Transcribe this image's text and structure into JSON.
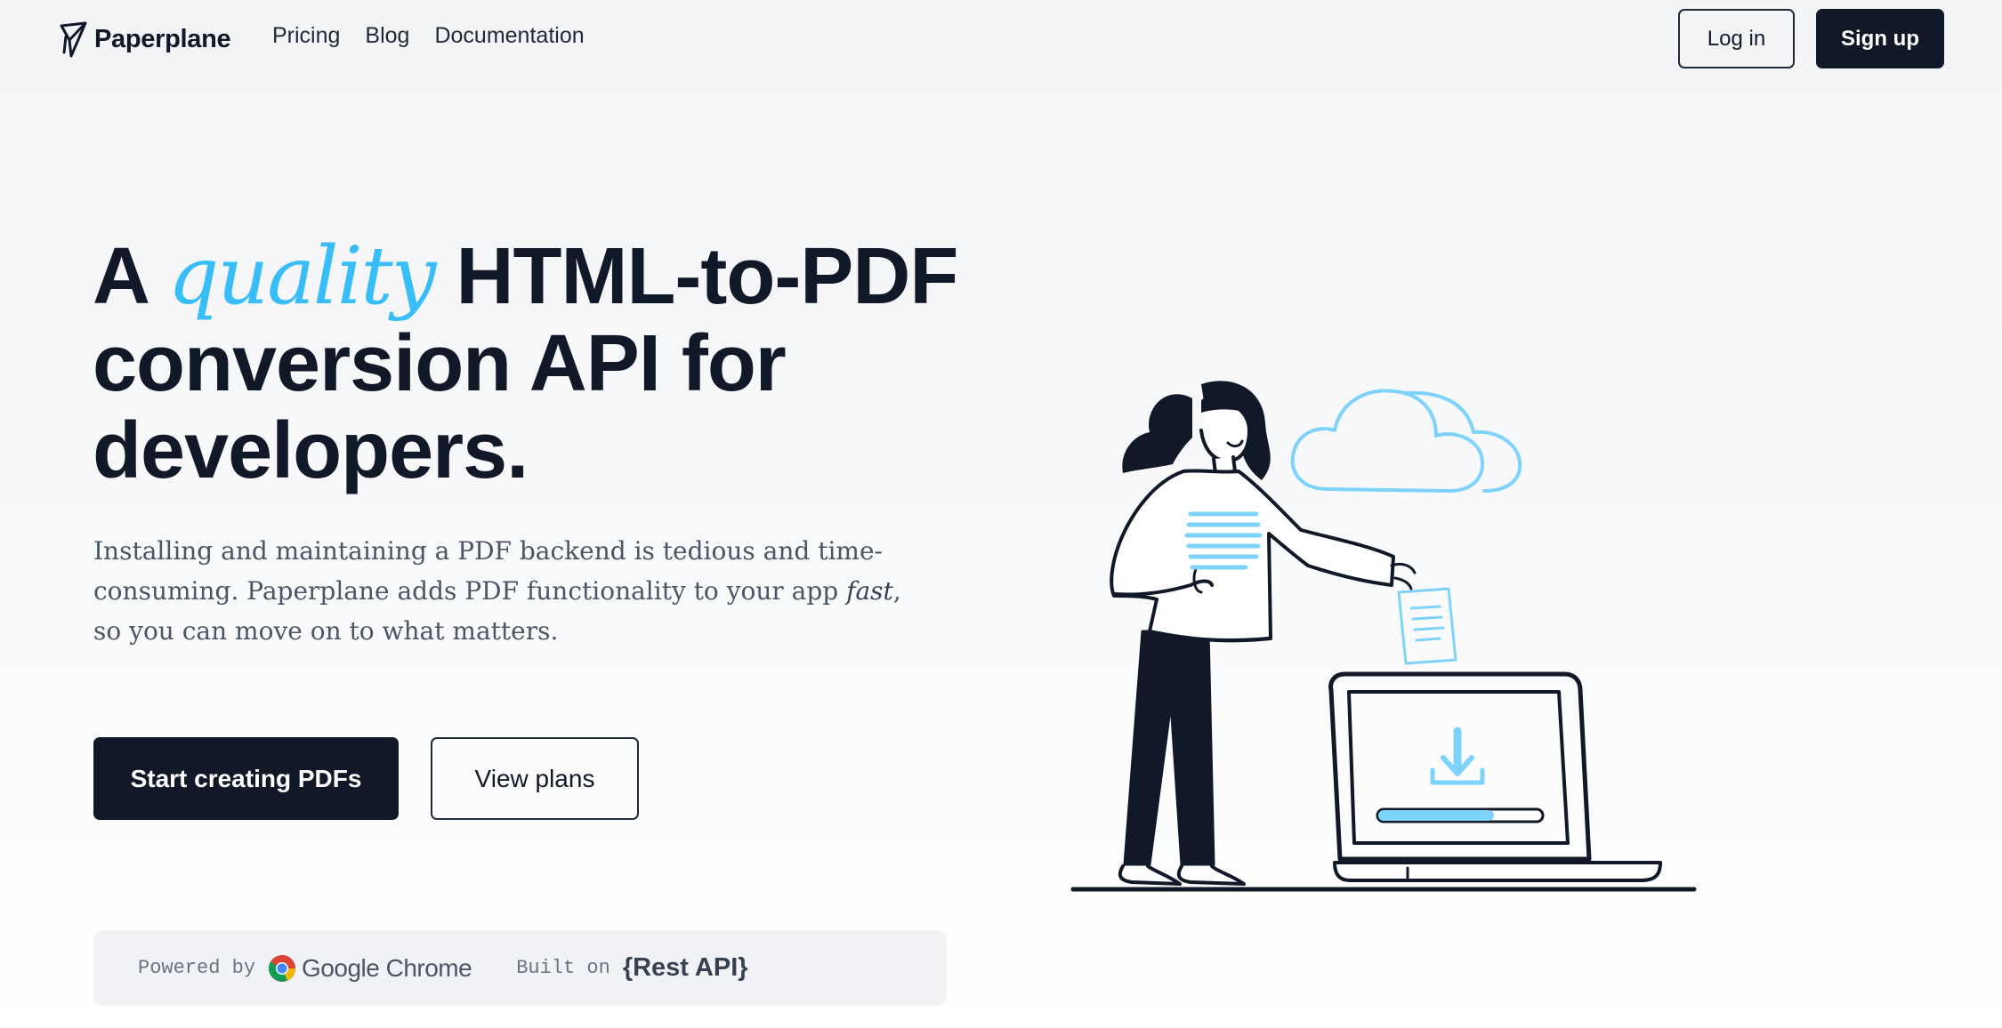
{
  "nav": {
    "brand": "Paperplane",
    "links": [
      "Pricing",
      "Blog",
      "Documentation"
    ],
    "login_label": "Log in",
    "signup_label": "Sign up"
  },
  "hero": {
    "headline_prefix": "A ",
    "headline_accent": "quality",
    "headline_line1_rest": " HTML-to-PDF",
    "headline_line2": "conversion API for",
    "headline_line3": "developers.",
    "subtext_part1": "Installing and maintaining a PDF backend is tedious and time-consuming. Paperplane adds PDF functionality to your app ",
    "subtext_emphasis": "fast",
    "subtext_part2": ", so you can move on to what matters.",
    "primary_cta": "Start creating PDFs",
    "secondary_cta": "View plans"
  },
  "powered_bar": {
    "powered_label": "Powered by",
    "powered_brand": "Google Chrome",
    "built_label": "Built on",
    "built_brand": "{Rest API}"
  },
  "icons": {
    "brand": "paper-plane-icon",
    "chrome": "google-chrome-logo",
    "illustration": "woman-uploading-document-illustration"
  },
  "colors": {
    "primary": "#111827",
    "accent": "#38bdf8",
    "muted_text": "#4b5563"
  }
}
